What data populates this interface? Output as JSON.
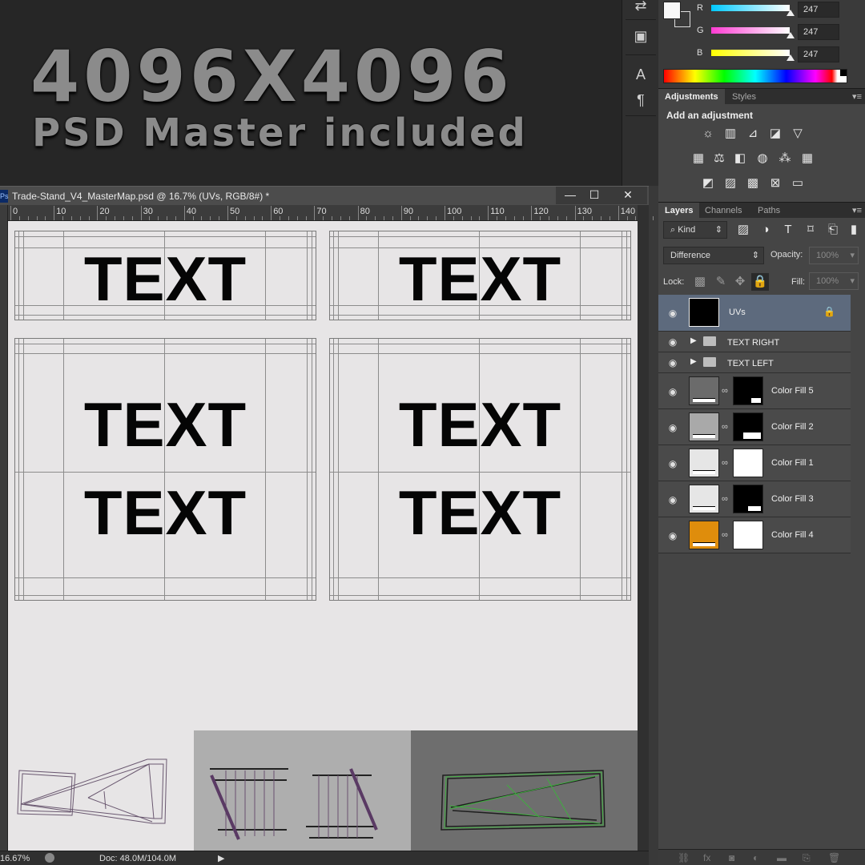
{
  "banner": {
    "title": "4096X4096",
    "subtitle": "PSD Master included"
  },
  "color_panel": {
    "channels": [
      {
        "label": "R",
        "value": "247",
        "color": "#00c8ff"
      },
      {
        "label": "G",
        "value": "247",
        "color": "#ff3cd2"
      },
      {
        "label": "B",
        "value": "247",
        "color": "#ffff00"
      }
    ]
  },
  "adjustments": {
    "tabs": [
      "Adjustments",
      "Styles"
    ],
    "heading": "Add an adjustment"
  },
  "layers_panel": {
    "tabs": [
      "Layers",
      "Channels",
      "Paths"
    ],
    "filter_kind": "Kind",
    "blend_mode": "Difference",
    "opacity_label": "Opacity:",
    "opacity_value": "100%",
    "lock_label": "Lock:",
    "fill_label": "Fill:",
    "fill_value": "100%",
    "layers": [
      {
        "name": "UVs",
        "kind": "pixel",
        "thumb_color": "#000000",
        "selected": true
      },
      {
        "name": "TEXT RIGHT",
        "kind": "group"
      },
      {
        "name": "TEXT LEFT",
        "kind": "group"
      },
      {
        "name": "Color Fill 5",
        "kind": "fill",
        "thumb_color": "#6b6b6b",
        "mask": "black"
      },
      {
        "name": "Color Fill 2",
        "kind": "fill",
        "thumb_color": "#a9a9a9",
        "mask": "black"
      },
      {
        "name": "Color Fill 1",
        "kind": "fill",
        "thumb_color": "#e6e6e6",
        "mask": "white"
      },
      {
        "name": "Color Fill 3",
        "kind": "fill",
        "thumb_color": "#e6e6e6",
        "mask": "black"
      },
      {
        "name": "Color Fill 4",
        "kind": "fill",
        "thumb_color": "#df8d0c",
        "mask": "white"
      }
    ]
  },
  "document": {
    "title": "Trade-Stand_V4_MasterMap.psd @ 16.7% (UVs, RGB/8#) *",
    "ps_badge": "Ps",
    "ruler_ticks": [
      "0",
      "10",
      "20",
      "30",
      "40",
      "50",
      "60",
      "70",
      "80",
      "90",
      "100",
      "110",
      "120",
      "130",
      "140"
    ],
    "canvas_text": [
      "TEXT",
      "TEXT",
      "TEXT",
      "TEXT",
      "TEXT",
      "TEXT"
    ],
    "uv_backgrounds": [
      "#e7e5e6",
      "#aeaeae",
      "#6e6e6e"
    ]
  },
  "status_bar": {
    "zoom": "16.67%",
    "doc_size": "Doc: 48.0M/104.0M"
  },
  "window_controls": {
    "minimize": "—",
    "maximize": "☐",
    "close": "✕"
  }
}
